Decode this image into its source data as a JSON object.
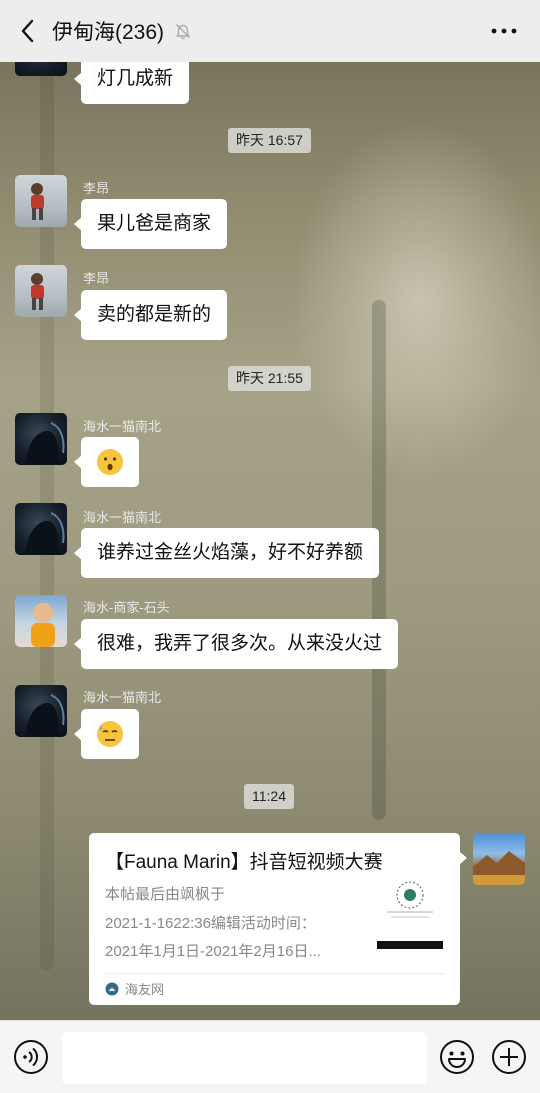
{
  "header": {
    "title": "伊甸海(236)",
    "back_icon": "chevron-left-icon",
    "mute_icon": "bell-muted-icon",
    "more_icon": "more-dots-icon"
  },
  "messages": {
    "m0": {
      "text": "灯几成新"
    },
    "ts1": "昨天 16:57",
    "m1": {
      "sender": "李昂",
      "text": "果儿爸是商家"
    },
    "m2": {
      "sender": "李昂",
      "text": "卖的都是新的"
    },
    "ts2": "昨天 21:55",
    "m3": {
      "sender": "海水一猫南北",
      "text": "😯"
    },
    "m4": {
      "sender": "海水一猫南北",
      "text": "谁养过金丝火焰藻，好不好养额"
    },
    "m5": {
      "sender": "海水-商家-石头",
      "text": "很难，我弄了很多次。从来没火过"
    },
    "m6": {
      "sender": "海水一猫南北",
      "text": "😓"
    },
    "ts3": "11:24",
    "card": {
      "title": "【Fauna Marin】抖音短视频大赛",
      "desc_lines": [
        "本帖最后由飒枫于",
        "2021-1-1622:36编辑活动时间：",
        "2021年1月1日-2021年2月16日..."
      ],
      "source": "海友网"
    }
  },
  "input_bar": {
    "voice_icon": "voice-icon",
    "emoji_icon": "emoji-icon",
    "plus_icon": "plus-icon"
  }
}
